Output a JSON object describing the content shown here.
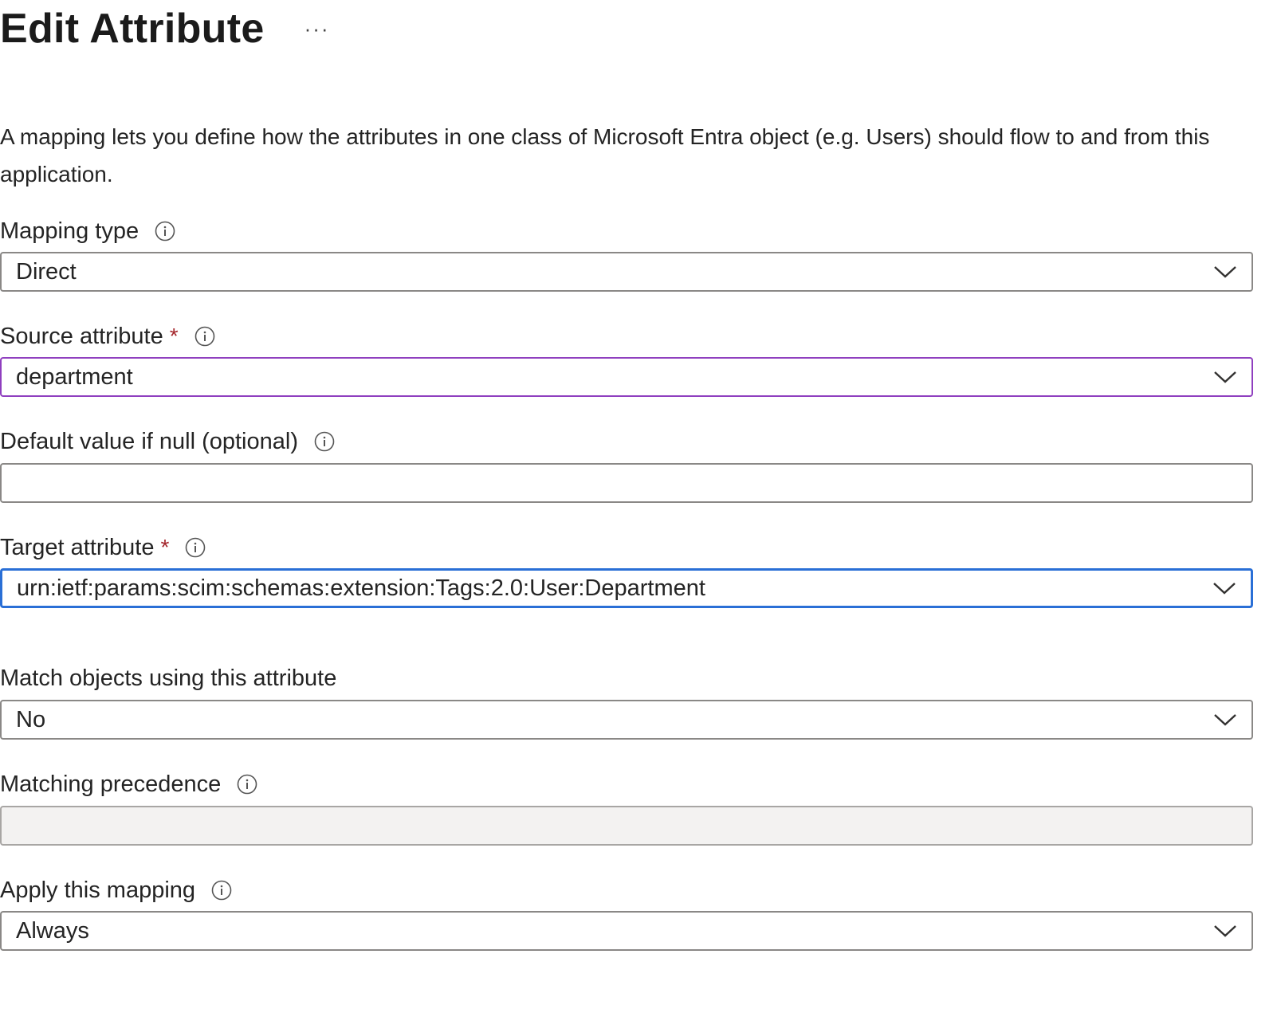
{
  "header": {
    "title": "Edit Attribute",
    "more_label": "···"
  },
  "description": "A mapping lets you define how the attributes in one class of Microsoft Entra object (e.g. Users) should flow to and from this application.",
  "required_marker": "*",
  "fields": {
    "mapping_type": {
      "label": "Mapping type",
      "value": "Direct"
    },
    "source_attribute": {
      "label": "Source attribute",
      "value": "department"
    },
    "default_value": {
      "label": "Default value if null (optional)",
      "value": ""
    },
    "target_attribute": {
      "label": "Target attribute",
      "value": "urn:ietf:params:scim:schemas:extension:Tags:2.0:User:Department"
    },
    "match_objects": {
      "label": "Match objects using this attribute",
      "value": "No"
    },
    "matching_precedence": {
      "label": "Matching precedence",
      "value": ""
    },
    "apply_mapping": {
      "label": "Apply this mapping",
      "value": "Always"
    }
  },
  "icons": {
    "info": "info-icon",
    "dropdown": "chevron-down-icon",
    "more": "more-icon"
  },
  "colors": {
    "source_focus_border": "#8f3fbf",
    "target_focus_border": "#2a6fd6",
    "required": "#a4262c",
    "disabled_bg": "#f3f2f1"
  }
}
